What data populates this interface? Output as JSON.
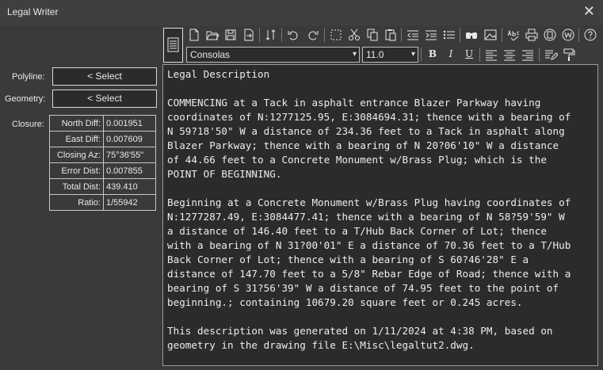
{
  "window": {
    "title": "Legal Writer",
    "close_glyph": "✕"
  },
  "left_panel": {
    "polyline_label": "Polyline:",
    "polyline_button": "< Select",
    "geometry_label": "Geometry:",
    "geometry_button": "< Select",
    "closure_label": "Closure:",
    "closure_rows": [
      {
        "label": "North Diff:",
        "value": "0.001951"
      },
      {
        "label": "East Diff:",
        "value": "0.007609"
      },
      {
        "label": "Closing Az:",
        "value": "75°36'55\""
      },
      {
        "label": "Error Dist:",
        "value": "0.007855"
      },
      {
        "label": "Total Dist:",
        "value": "439.410"
      },
      {
        "label": "Ratio:",
        "value": "1/55942"
      }
    ]
  },
  "toolbar": {
    "icons": [
      "new-file-icon",
      "open-folder-icon",
      "save-icon",
      "export-icon",
      "sort-icon",
      "undo-icon",
      "redo-icon",
      "select-region-icon",
      "cut-icon",
      "copy-icon",
      "paste-icon",
      "outdent-icon",
      "indent-icon",
      "bullet-list-icon",
      "find-icon",
      "image-icon",
      "spell-check-icon",
      "print-icon",
      "export-pdf-icon",
      "export-word-icon",
      "help-icon"
    ],
    "font_name": "Consolas",
    "font_size": "11.0",
    "bold_label": "B",
    "italic_label": "I",
    "underline_label": "U"
  },
  "editor": {
    "lines": [
      "Legal Description",
      "",
      "COMMENCING at a Tack in asphalt entrance Blazer Parkway having",
      "coordinates of N:1277125.95, E:3084694.31; thence with a bearing of",
      "N 59?18'50\" W a distance of 234.36 feet to a Tack in asphalt along",
      "Blazer Parkway; thence with a bearing of N 20?06'10\" W a distance",
      "of 44.66 feet to a Concrete Monument w/Brass Plug; which is the",
      "POINT OF BEGINNING.",
      "",
      "Beginning at a Concrete Monument w/Brass Plug having coordinates of",
      "N:1277287.49, E:3084477.41; thence with a bearing of N 58?59'59\" W",
      "a distance of 146.40 feet to a T/Hub Back Corner of Lot; thence",
      "with a bearing of N 31?00'01\" E a distance of 70.36 feet to a T/Hub",
      "Back Corner of Lot; thence with a bearing of S 60?46'28\" E a",
      "distance of 147.70 feet to a 5/8\" Rebar Edge of Road; thence with a",
      "bearing of S 31?56'39\" W a distance of 74.95 feet to the point of",
      "beginning.; containing 10679.20 square feet or 0.245 acres.",
      "",
      "This description was generated on 1/11/2024 at 4:38 PM, based on",
      "geometry in the drawing file E:\\Misc\\legaltut2.dwg."
    ]
  }
}
